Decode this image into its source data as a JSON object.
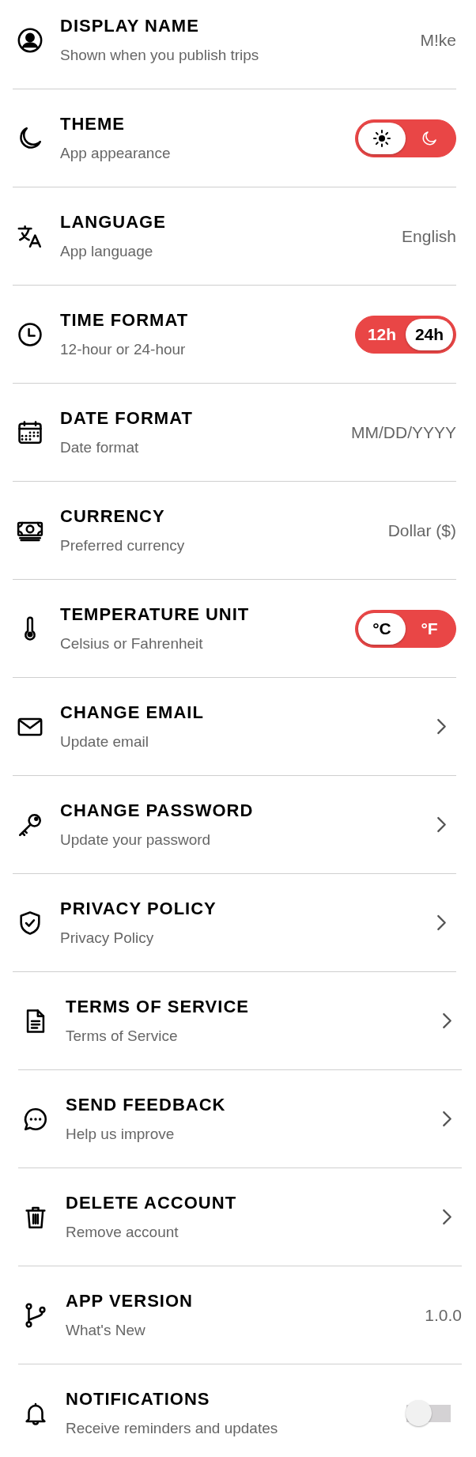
{
  "groups": [
    {
      "rows": [
        {
          "kind": "value",
          "title": "DISPLAY NAME",
          "subtitle": "Shown when you publish trips",
          "value": "M!ke"
        },
        {
          "kind": "segmented",
          "title": "THEME",
          "subtitle": "App appearance",
          "options": [
            {
              "selected": true
            },
            {
              "selected": false
            }
          ]
        },
        {
          "kind": "value",
          "title": "LANGUAGE",
          "subtitle": "App language",
          "value": "English"
        },
        {
          "kind": "segmented",
          "title": "TIME FORMAT",
          "subtitle": "12-hour or 24-hour",
          "options": [
            {
              "label": "12h",
              "selected": false
            },
            {
              "label": "24h",
              "selected": true
            }
          ]
        },
        {
          "kind": "value",
          "title": "DATE FORMAT",
          "subtitle": "Date format",
          "value": "MM/DD/YYYY"
        },
        {
          "kind": "value",
          "title": "CURRENCY",
          "subtitle": "Preferred currency",
          "value": "Dollar ($)"
        },
        {
          "kind": "segmented",
          "title": "TEMPERATURE UNIT",
          "subtitle": "Celsius or Fahrenheit",
          "options": [
            {
              "label": "°C",
              "selected": true
            },
            {
              "label": "°F",
              "selected": false
            }
          ]
        },
        {
          "kind": "chevron",
          "title": "CHANGE EMAIL",
          "subtitle": "Update email"
        },
        {
          "kind": "chevron",
          "title": "CHANGE PASSWORD",
          "subtitle": "Update your password"
        },
        {
          "kind": "chevron",
          "title": "PRIVACY POLICY",
          "subtitle": "Privacy Policy"
        }
      ]
    },
    {
      "rows": [
        {
          "kind": "chevron",
          "title": "TERMS OF SERVICE",
          "subtitle": "Terms of Service"
        },
        {
          "kind": "chevron",
          "title": "SEND FEEDBACK",
          "subtitle": "Help us improve"
        },
        {
          "kind": "chevron",
          "title": "DELETE ACCOUNT",
          "subtitle": "Remove account"
        },
        {
          "kind": "value",
          "title": "APP VERSION",
          "subtitle": "What's New",
          "value": "1.0.0"
        },
        {
          "kind": "switch",
          "title": "NOTIFICATIONS",
          "subtitle": "Receive reminders and updates",
          "on": false
        }
      ]
    }
  ]
}
